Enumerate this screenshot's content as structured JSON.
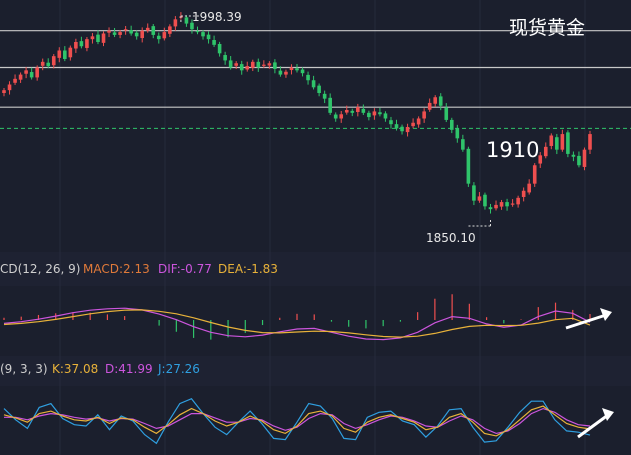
{
  "chart_title": "现货黄金",
  "annotations": {
    "high_label": "1998.39",
    "low_label": "1850.10",
    "level_label": "1910"
  },
  "macd_panel": {
    "name": "CD(12, 26, 9)",
    "macd": "MACD:2.13",
    "dif": "DIF:-0.77",
    "dea": "DEA:-1.83"
  },
  "kdj_panel": {
    "name": "(9, 3, 3)",
    "k": "K:37.08",
    "d": "D:41.99",
    "j": "J:27.26"
  },
  "colors": {
    "background": "#1b1f2d",
    "up": "#ef4f4f",
    "down": "#2fc46a",
    "macd_label": "#e07a3a",
    "dif": "#cc55dd",
    "dea": "#e8b23a",
    "k": "#e8b23a",
    "d": "#cc55dd",
    "j": "#2f9fe0",
    "current_line": "#2fc46a",
    "level": "#c8c8c8"
  },
  "chart_data": [
    {
      "type": "candlestick",
      "y_range": [
        1836,
        2004
      ],
      "levels": [
        1988,
        1962,
        1934
      ],
      "current_price": 1919,
      "high": 1998.39,
      "low": 1850.1,
      "close": [
        1946,
        1950,
        1954,
        1957,
        1960,
        1955,
        1962,
        1966,
        1963,
        1970,
        1974,
        1968,
        1976,
        1980,
        1977,
        1982,
        1984,
        1980,
        1986,
        1988,
        1985,
        1987,
        1989,
        1986,
        1984,
        1988,
        1990,
        1985,
        1982,
        1987,
        1991,
        1996,
        1998,
        1993,
        1989,
        1987,
        1984,
        1982,
        1978,
        1972,
        1967,
        1962,
        1965,
        1960,
        1963,
        1966,
        1962,
        1964,
        1965,
        1961,
        1957,
        1959,
        1962,
        1960,
        1958,
        1953,
        1948,
        1944,
        1940,
        1930,
        1926,
        1929,
        1932,
        1930,
        1934,
        1930,
        1927,
        1931,
        1929,
        1926,
        1922,
        1919,
        1917,
        1920,
        1923,
        1926,
        1931,
        1937,
        1941,
        1935,
        1925,
        1918,
        1912,
        1904,
        1880,
        1868,
        1871,
        1864,
        1862,
        1865,
        1867,
        1864,
        1866,
        1870,
        1875,
        1880,
        1893,
        1900,
        1906,
        1914,
        1904,
        1915,
        1901,
        1899,
        1893,
        1904,
        1915
      ],
      "open_seed": "derived from close"
    },
    {
      "type": "line",
      "name": "MACD",
      "series": [
        {
          "name": "DIF",
          "values": [
            -1.2,
            -0.6,
            0.3,
            1.4,
            2.6,
            3.5,
            4.0,
            4.2,
            3.6,
            2.1,
            0.1,
            -2.4,
            -4.4,
            -5.6,
            -6.0,
            -5.4,
            -4.2,
            -3.2,
            -3.0,
            -4.4,
            -5.8,
            -6.8,
            -7.0,
            -6.4,
            -4.4,
            -1.0,
            1.2,
            0.6,
            -1.4,
            -2.6,
            -1.8,
            1.2,
            3.2,
            2.4,
            -0.77
          ]
        },
        {
          "name": "DEA",
          "values": [
            -1.6,
            -1.2,
            -0.6,
            0.2,
            1.2,
            2.2,
            3.0,
            3.5,
            3.6,
            3.1,
            2.2,
            0.8,
            -0.9,
            -2.5,
            -3.7,
            -4.5,
            -4.6,
            -4.3,
            -4.0,
            -4.1,
            -4.6,
            -5.3,
            -5.9,
            -6.1,
            -5.8,
            -4.8,
            -3.4,
            -2.3,
            -1.9,
            -2.0,
            -1.9,
            -1.1,
            0.1,
            0.6,
            -1.83
          ]
        },
        {
          "name": "MACD",
          "values": [
            0.8,
            1.2,
            1.8,
            2.4,
            2.8,
            2.6,
            2.0,
            1.4,
            0.0,
            -2.0,
            -4.2,
            -6.4,
            -7.0,
            -6.2,
            -4.6,
            -1.8,
            0.8,
            2.2,
            2.0,
            -0.6,
            -2.4,
            -3.0,
            -2.2,
            -0.6,
            2.8,
            7.6,
            9.2,
            5.8,
            1.0,
            -1.2,
            0.2,
            4.6,
            6.2,
            3.6,
            2.13
          ]
        }
      ]
    },
    {
      "type": "line",
      "name": "KDJ",
      "y_range": [
        0,
        100
      ],
      "series": [
        {
          "name": "K",
          "values": [
            60,
            55,
            48,
            62,
            66,
            58,
            52,
            50,
            56,
            46,
            55,
            52,
            40,
            30,
            44,
            60,
            70,
            62,
            50,
            42,
            48,
            58,
            50,
            36,
            30,
            42,
            62,
            66,
            58,
            38,
            32,
            48,
            56,
            60,
            54,
            48,
            36,
            40,
            56,
            62,
            48,
            30,
            26,
            36,
            52,
            68,
            74,
            60,
            46,
            40,
            37.08
          ]
        },
        {
          "name": "D",
          "values": [
            56,
            56,
            52,
            58,
            62,
            60,
            56,
            53,
            55,
            50,
            54,
            53,
            46,
            38,
            42,
            52,
            62,
            62,
            55,
            48,
            48,
            54,
            52,
            42,
            35,
            40,
            54,
            62,
            60,
            46,
            38,
            44,
            52,
            58,
            56,
            50,
            42,
            40,
            50,
            58,
            52,
            38,
            30,
            34,
            46,
            62,
            70,
            64,
            52,
            44,
            41.99
          ]
        },
        {
          "name": "J",
          "values": [
            70,
            52,
            38,
            72,
            78,
            54,
            44,
            42,
            60,
            36,
            58,
            50,
            28,
            14,
            48,
            78,
            86,
            62,
            40,
            28,
            48,
            66,
            46,
            22,
            20,
            48,
            78,
            74,
            54,
            22,
            20,
            56,
            64,
            66,
            50,
            44,
            24,
            42,
            68,
            70,
            40,
            16,
            18,
            40,
            64,
            82,
            82,
            52,
            34,
            32,
            27.26
          ]
        }
      ]
    }
  ]
}
